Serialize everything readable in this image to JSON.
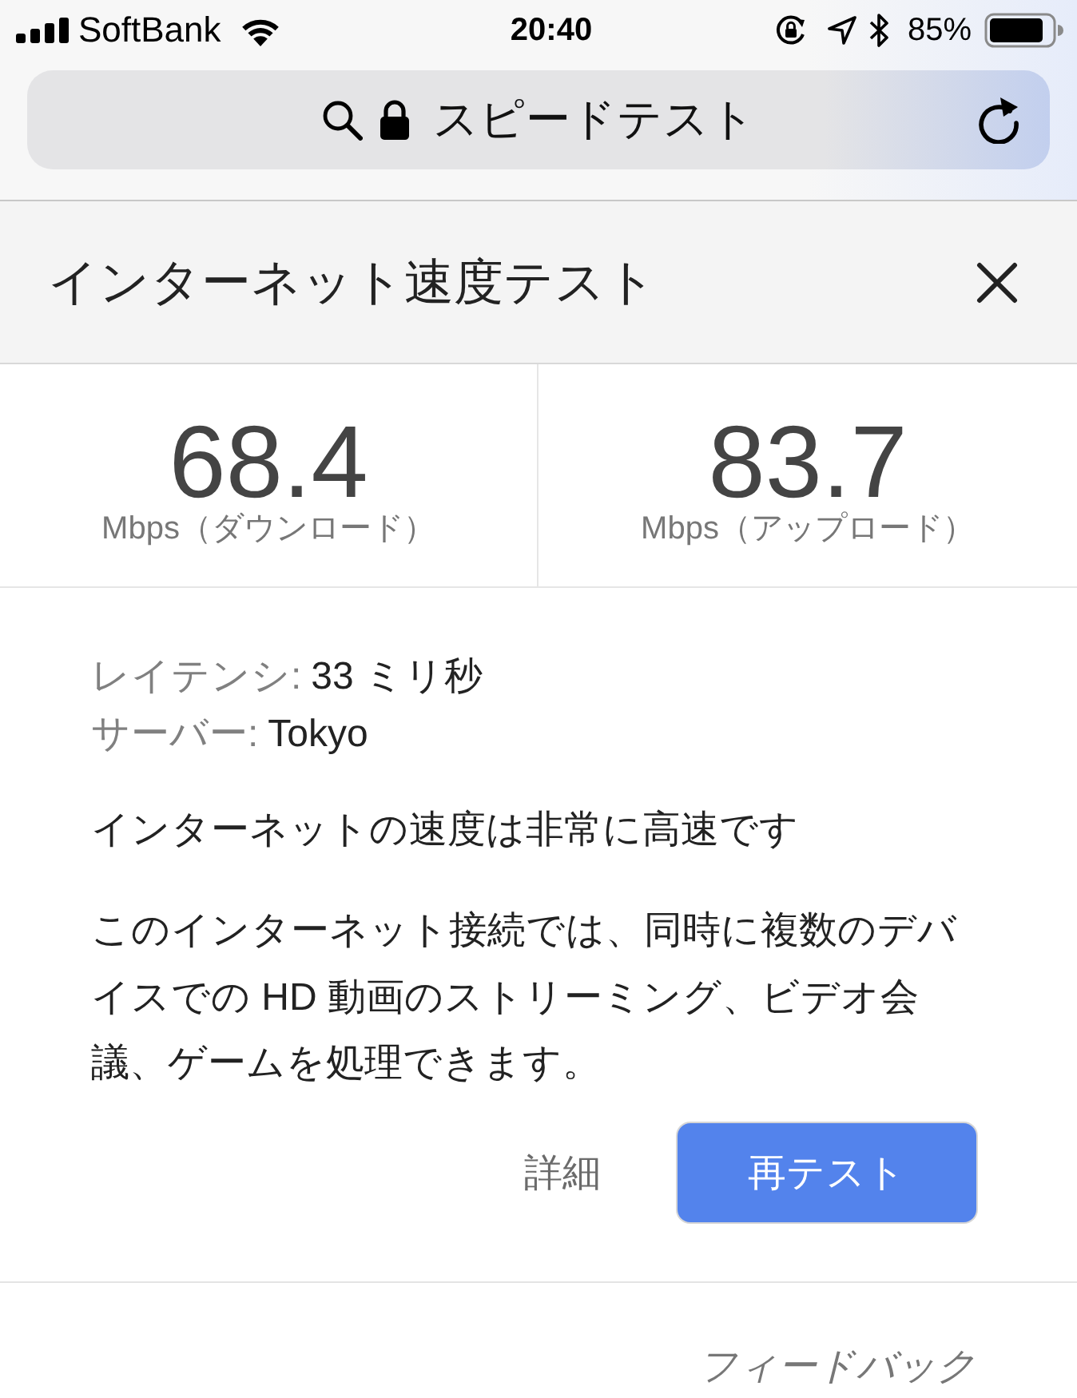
{
  "status_bar": {
    "carrier": "SoftBank",
    "time": "20:40",
    "battery": "85%"
  },
  "address_bar": {
    "title": "スピードテスト"
  },
  "dialog": {
    "title": "インターネット速度テスト",
    "results": [
      {
        "value": "68.4",
        "label": "Mbps（ダウンロード）"
      },
      {
        "value": "83.7",
        "label": "Mbps（アップロード）"
      }
    ],
    "details": [
      {
        "label": "レイテンシ:",
        "value": "33 ミリ秒"
      },
      {
        "label": "サーバー:",
        "value": "Tokyo"
      }
    ],
    "summary": "インターネットの速度は非常に高速です",
    "description": "このインターネット接続では、同時に複数のデバイスでの HD 動画のストリーミング、ビデオ会議、ゲームを処理できます。",
    "buttons": [
      {
        "kind": "text",
        "label": "詳細"
      },
      {
        "kind": "primary",
        "label": "再テスト"
      }
    ],
    "feedback_link": "フィードバック"
  }
}
